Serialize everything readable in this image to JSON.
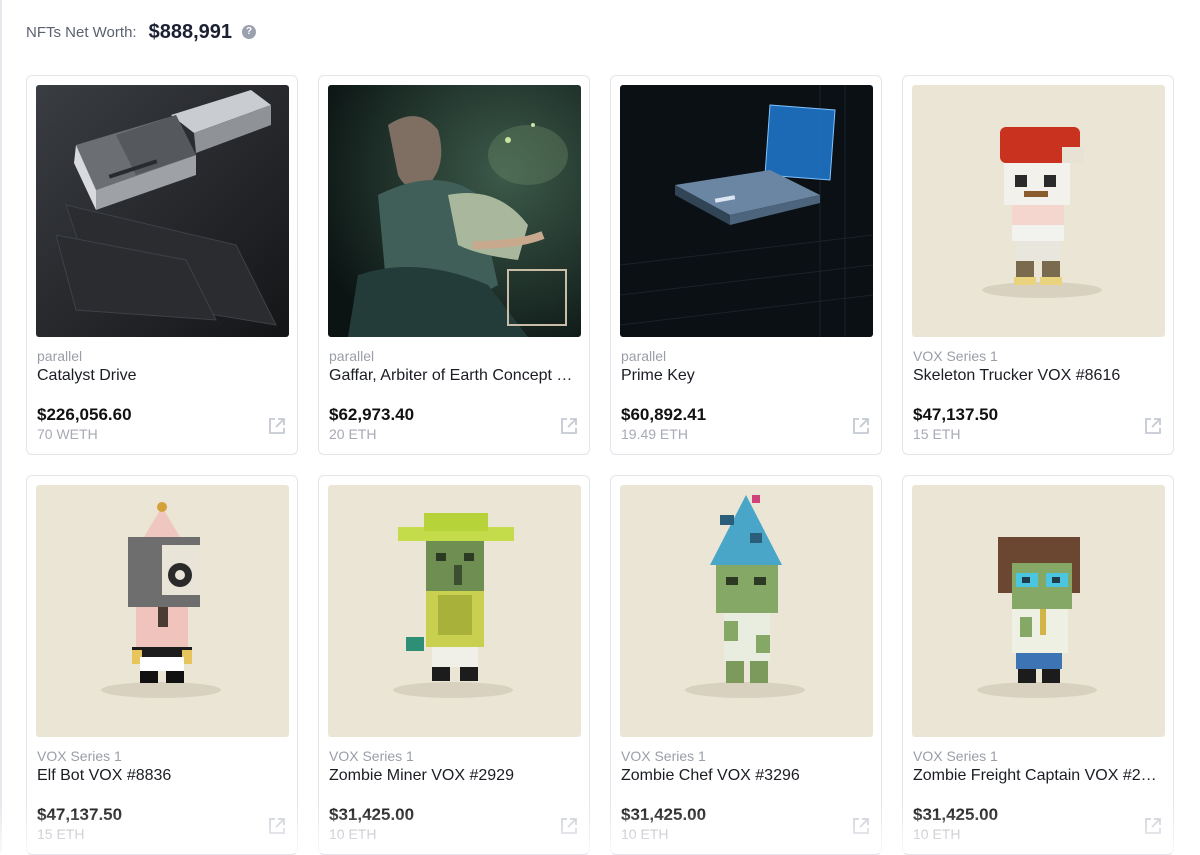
{
  "header": {
    "net_worth_label": "NFTs Net Worth:",
    "net_worth_value": "$888,991",
    "help_icon": "question-circle-icon"
  },
  "colors": {
    "page_bg": "#ffffff",
    "card_border": "#e3e5ea",
    "muted_text": "#9a9ea8",
    "vox_bg": "#ebe5d6"
  },
  "cards": [
    {
      "collection": "parallel",
      "name": "Catalyst Drive",
      "usd": "$226,056.60",
      "crypto": "70 WETH",
      "art": "dark-device-render"
    },
    {
      "collection": "parallel",
      "name": "Gaffar, Arbiter of Earth Concept …",
      "usd": "$62,973.40",
      "crypto": "20 ETH",
      "art": "painted-figure-smoking"
    },
    {
      "collection": "parallel",
      "name": "Prime Key",
      "usd": "$60,892.41",
      "crypto": "19.49 ETH",
      "art": "glowing-blue-key-card"
    },
    {
      "collection": "VOX Series 1",
      "name": "Skeleton Trucker VOX #8616",
      "usd": "$47,137.50",
      "crypto": "15 ETH",
      "art": "voxel-skeleton-red-cap"
    },
    {
      "collection": "VOX Series 1",
      "name": "Elf Bot VOX #8836",
      "usd": "$47,137.50",
      "crypto": "15 ETH",
      "art": "voxel-robot-party-hat"
    },
    {
      "collection": "VOX Series 1",
      "name": "Zombie Miner VOX #2929",
      "usd": "$31,425.00",
      "crypto": "10 ETH",
      "art": "voxel-zombie-green-hat"
    },
    {
      "collection": "VOX Series 1",
      "name": "Zombie Chef VOX #3296",
      "usd": "$31,425.00",
      "crypto": "10 ETH",
      "art": "voxel-zombie-blue-hat"
    },
    {
      "collection": "VOX Series 1",
      "name": "Zombie Freight Captain VOX #27…",
      "usd": "$31,425.00",
      "crypto": "10 ETH",
      "art": "voxel-zombie-brown-hair"
    }
  ]
}
